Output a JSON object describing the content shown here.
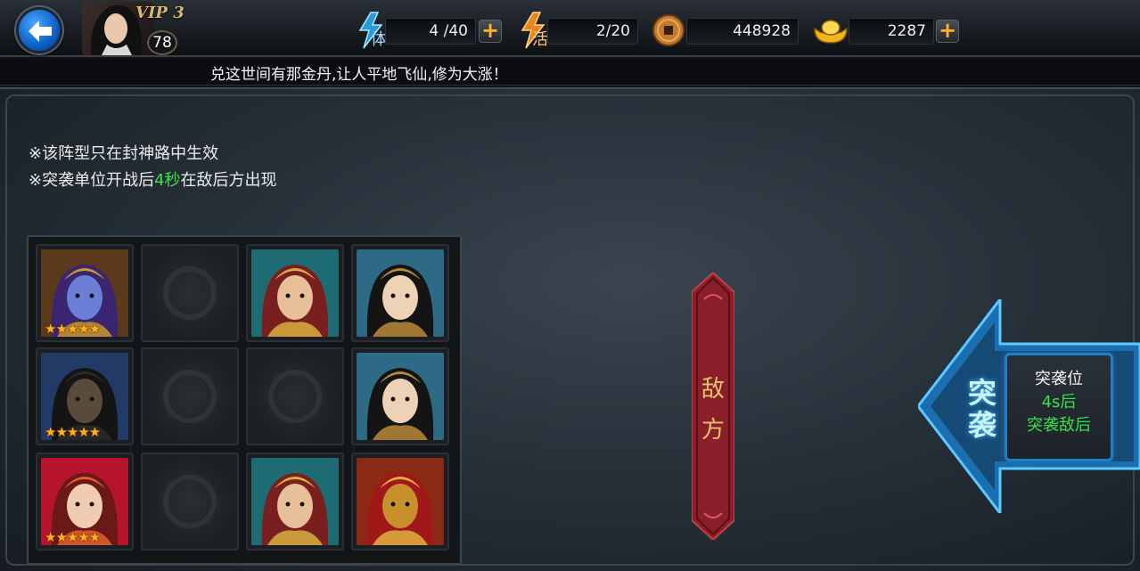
{
  "header": {
    "vip": "VIP 3",
    "level": "78",
    "stamina": {
      "label": "体",
      "value": "4 /40"
    },
    "vigor": {
      "label": "活",
      "value": "2/20"
    },
    "coins": {
      "value": "448928"
    },
    "ingots": {
      "value": "2287"
    },
    "plus_label": "+"
  },
  "ticker": "兑这世间有那金丹,让人平地飞仙,修为大涨！",
  "tips": {
    "line1": "※该阵型只在封神路中生效",
    "line2_prefix": "※突袭单位开战后",
    "line2_highlight": "4秒",
    "line2_suffix": "在敌后方出现"
  },
  "formation": {
    "slots": [
      {
        "hero": "purple-demon",
        "stars": "★★★★★"
      },
      {
        "hero": null,
        "stars": ""
      },
      {
        "hero": "golden-helmet-general",
        "stars": ""
      },
      {
        "hero": "young-scholar",
        "stars": ""
      },
      {
        "hero": "dark-bearded-general",
        "stars": "★★★★★"
      },
      {
        "hero": null,
        "stars": ""
      },
      {
        "hero": null,
        "stars": ""
      },
      {
        "hero": "young-scholar",
        "stars": ""
      },
      {
        "hero": "red-hair-girl",
        "stars": "★★★★★"
      },
      {
        "hero": null,
        "stars": ""
      },
      {
        "hero": "golden-helmet-general",
        "stars": ""
      },
      {
        "hero": "golden-mask-warrior",
        "stars": ""
      }
    ]
  },
  "enemy_side": {
    "line1": "敌",
    "line2": "方"
  },
  "raid": {
    "arrow_line1": "突",
    "arrow_line2": "袭",
    "box_title": "突袭位",
    "box_line2": "4s后",
    "box_line3": "突袭敌后"
  },
  "colors": {
    "accent_blue": "#1e80c8",
    "highlight_green": "#3ee04a",
    "gold": "#ffb020",
    "banner_red": "#8a1f2a"
  }
}
